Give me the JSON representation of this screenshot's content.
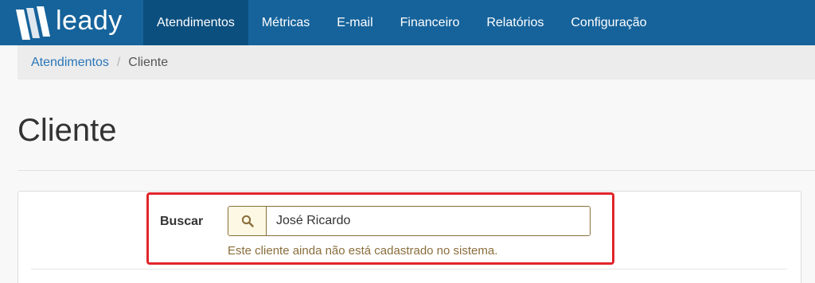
{
  "brand": {
    "name": "leady",
    "logo_icon": "leady-logo-icon"
  },
  "nav": {
    "items": [
      {
        "label": "Atendimentos",
        "active": true
      },
      {
        "label": "Métricas",
        "active": false
      },
      {
        "label": "E-mail",
        "active": false
      },
      {
        "label": "Financeiro",
        "active": false
      },
      {
        "label": "Relatórios",
        "active": false
      },
      {
        "label": "Configuração",
        "active": false
      }
    ]
  },
  "breadcrumb": {
    "items": [
      "Atendimentos",
      "Cliente"
    ],
    "separator": "/"
  },
  "page": {
    "title": "Cliente"
  },
  "search": {
    "label": "Buscar",
    "icon": "search-icon",
    "value": "José Ricardo",
    "help": "Este cliente ainda não está cadastrado no sistema."
  },
  "colors": {
    "navbar": "#16639b",
    "nav_active": "#0b4f7f",
    "link": "#2a76b9",
    "warning_text": "#8a6d3b",
    "warning_bg": "#fcf8e3",
    "highlight": "#e0252b"
  }
}
